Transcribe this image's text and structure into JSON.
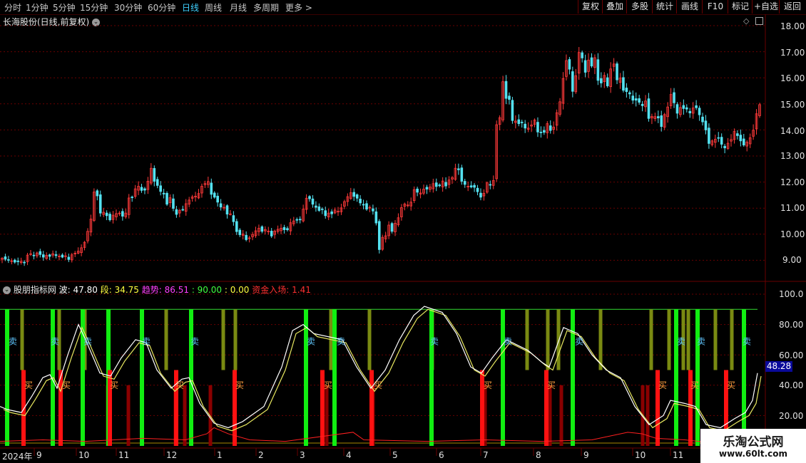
{
  "toolbar": {
    "periods": [
      "分时",
      "1分钟",
      "5分钟",
      "15分钟",
      "30分钟",
      "60分钟",
      "日线",
      "周线",
      "月线",
      "多周期",
      "更多"
    ],
    "active_period": "日线",
    "buttons": [
      "复权",
      "叠加",
      "多股",
      "统计",
      "画线",
      "F10",
      "标记",
      "+自选",
      "返回"
    ]
  },
  "main_chart": {
    "title": "长海股份(日线,前复权)",
    "price_axis": [
      "18.00",
      "17.00",
      "16.00",
      "15.00",
      "14.00",
      "13.00",
      "12.00",
      "11.00",
      "10.00",
      "9.00"
    ]
  },
  "indicator": {
    "name": "股朋指标网",
    "items": [
      {
        "label": "波: ",
        "value": "47.80",
        "color": "#ffffff"
      },
      {
        "label": "段: ",
        "value": "34.75",
        "color": "#ffff40"
      },
      {
        "label": "趋势: ",
        "value": "86.51",
        "color": "#ff40ff"
      },
      {
        "label": ": ",
        "value": "90.00",
        "color": "#40ff40"
      },
      {
        "label": ": ",
        "value": "0.00",
        "color": "#ffff40"
      },
      {
        "label": "资金入场: ",
        "value": "1.41",
        "color": "#ff3030"
      }
    ],
    "axis": [
      "100.0",
      "80.00",
      "60.00",
      "40.00",
      "20.00"
    ],
    "current_value": "48.28",
    "sell_label": "卖",
    "buy_label": "买"
  },
  "time_axis": [
    "2024年",
    "9",
    "10",
    "11",
    "12",
    "1",
    "2",
    "3",
    "4",
    "5",
    "6",
    "7",
    "8",
    "9",
    "10",
    "11"
  ],
  "watermark": {
    "line1": "乐淘公式网",
    "line2": "www.60lt.com"
  },
  "colors": {
    "up": "#ff3a3a",
    "down": "#54e1f0",
    "grid": "#6a0000",
    "bar_green": "#11ee11",
    "bar_red": "#ff1111",
    "bar_olive": "#7a8a12",
    "bar_darkred": "#8a0000"
  },
  "chart_data": {
    "type": "candlestick",
    "ylim": [
      8.7,
      18.3
    ],
    "indicator_ylim": [
      0,
      100
    ],
    "close": [
      9.08,
      9.04,
      9.02,
      8.98,
      8.93,
      8.95,
      8.96,
      8.9,
      9.2,
      9.25,
      9.18,
      9.28,
      9.22,
      9.12,
      9.19,
      9.15,
      9.25,
      9.18,
      9.16,
      9.12,
      9.17,
      9.03,
      9.21,
      9.27,
      9.35,
      9.48,
      9.69,
      10.11,
      10.58,
      11.62,
      11.47,
      10.81,
      10.84,
      10.71,
      10.55,
      10.73,
      10.79,
      10.81,
      10.69,
      10.81,
      11.39,
      11.4,
      11.74,
      11.84,
      11.68,
      11.69,
      12.03,
      12.53,
      12.03,
      11.87,
      11.64,
      11.54,
      11.15,
      11.4,
      10.99,
      10.76,
      10.92,
      10.94,
      11.17,
      11.31,
      11.43,
      11.46,
      11.56,
      11.84,
      11.94,
      12.02,
      11.53,
      11.42,
      11.23,
      11.04,
      11.03,
      10.77,
      10.78,
      10.48,
      10.1,
      9.98,
      10.01,
      9.79,
      9.86,
      9.99,
      10.13,
      10.23,
      10.11,
      10.18,
      10.12,
      9.93,
      10.12,
      10.19,
      10.23,
      10.17,
      10.17,
      10.44,
      10.51,
      10.55,
      10.57,
      10.96,
      11.38,
      11.36,
      11.15,
      11.03,
      10.91,
      10.94,
      10.71,
      10.81,
      10.78,
      10.93,
      10.88,
      11.01,
      11.25,
      11.44,
      11.59,
      11.45,
      11.38,
      11.2,
      11.13,
      10.96,
      11.03,
      10.89,
      10.43,
      9.41,
      9.88,
      9.94,
      10.35,
      10.11,
      10.42,
      10.63,
      11.02,
      11.16,
      11.12,
      11.23,
      11.71,
      11.61,
      11.58,
      11.73,
      11.73,
      11.81,
      11.94,
      11.83,
      11.86,
      12.04,
      11.85,
      12.08,
      12.17,
      12.53,
      12.47,
      12.03,
      11.91,
      11.84,
      11.81,
      11.8,
      11.63,
      11.42,
      11.57,
      11.97,
      11.9,
      12.06,
      14.2,
      14.47,
      15.85,
      15.21,
      15.17,
      14.36,
      14.34,
      14.24,
      14.29,
      14.07,
      14.07,
      14.19,
      14.38,
      13.92,
      13.9,
      13.91,
      14.24,
      13.98,
      14.11,
      14.66,
      15.08,
      15.97,
      16.66,
      16.33,
      15.48,
      16.08,
      16.97,
      16.76,
      16.21,
      16.68,
      16.45,
      16.77,
      15.9,
      15.8,
      16.09,
      15.69,
      16.34,
      16.53,
      15.92,
      15.99,
      15.52,
      15.47,
      15.38,
      15.14,
      15.14,
      15.06,
      14.93,
      15.11,
      14.44,
      14.52,
      14.51,
      14.46,
      14.13,
      14.59,
      14.88,
      15.36,
      15.04,
      14.64,
      14.86,
      14.82,
      14.8,
      14.65,
      14.84,
      14.85,
      14.58,
      14.31,
      14.0,
      13.48,
      13.58,
      13.64,
      13.68,
      13.45,
      13.31,
      13.49,
      13.63,
      13.94,
      13.78,
      13.58,
      13.42,
      13.53,
      13.7,
      13.99,
      14.62,
      14.97
    ]
  }
}
